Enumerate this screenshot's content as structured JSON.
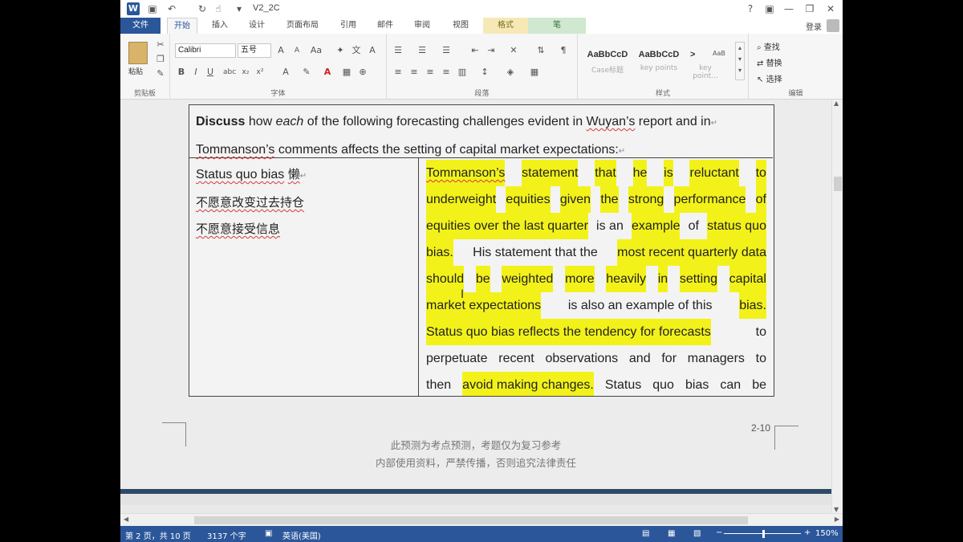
{
  "window": {
    "doc_title": "V2_2C",
    "help": "?",
    "min": "—",
    "restore": "❐",
    "close": "✕",
    "ribbon_display": "▣",
    "signin": "登录"
  },
  "tabs": {
    "file": "文件",
    "home": "开始",
    "insert": "插入",
    "design": "设计",
    "layout": "页面布局",
    "references": "引用",
    "mailings": "邮件",
    "review": "审阅",
    "view": "视图",
    "format": "格式",
    "pen": "笔"
  },
  "ribbon": {
    "clipboard": {
      "paste": "粘贴",
      "label": "剪贴板"
    },
    "font": {
      "name": "Calibri",
      "size": "五号",
      "label": "字体"
    },
    "paragraph": {
      "label": "段落"
    },
    "styles": {
      "label": "样式",
      "tiles": [
        {
          "sample": "AaBbCcD",
          "name": "Case标题"
        },
        {
          "sample": "AaBbCcD",
          "name": "key points"
        },
        {
          "sample": ">",
          "name": "key point..."
        }
      ],
      "more_sample": "AaB"
    },
    "editing": {
      "find": "查找",
      "replace": "替换",
      "select": "选择",
      "label": "编辑"
    }
  },
  "doc": {
    "question": {
      "b1": "Discuss",
      "t1": " how ",
      "i1": "each",
      "t2": " of the following forecasting challenges evident in ",
      "u1": "Wuyan’s",
      "t3": " report and in",
      "u2": "Tommanson’s",
      "t4": " comments affects the setting of capital market expectations:"
    },
    "left": {
      "l1": "Status quo bias",
      "l1_zh": "懒",
      "l2": "不愿意改变过去持仓",
      "l3": "不愿意接受信息"
    },
    "right_lines": [
      [
        {
          "t": "Tommanson’s",
          "hl": true,
          "u": true
        },
        {
          "t": "statement",
          "hl": true
        },
        {
          "t": "that",
          "hl": true
        },
        {
          "t": "he",
          "hl": true
        },
        {
          "t": "is",
          "hl": true
        },
        {
          "t": "reluctant",
          "hl": true
        },
        {
          "t": "to",
          "hl": true
        }
      ],
      [
        {
          "t": "underweight",
          "hl": true
        },
        {
          "t": "equities",
          "hl": true
        },
        {
          "t": "given",
          "hl": true
        },
        {
          "t": "the",
          "hl": true
        },
        {
          "t": "strong",
          "hl": true
        },
        {
          "t": "performance",
          "hl": true
        },
        {
          "t": "of",
          "hl": true
        }
      ],
      [
        {
          "t": "equities over the last quarter",
          "hl": true
        },
        {
          "t": "is an",
          "hl": false
        },
        {
          "t": "example",
          "hl": true
        },
        {
          "t": "of",
          "hl": false
        },
        {
          "t": "status quo",
          "hl": true
        }
      ],
      [
        {
          "t": "bias.",
          "hl": true
        },
        {
          "t": "His statement that the",
          "hl": false
        },
        {
          "t": "most recent quarterly data",
          "hl": true
        }
      ],
      [
        {
          "t": "should",
          "hl": true
        },
        {
          "t": "be",
          "hl": true
        },
        {
          "t": "weighted",
          "hl": true
        },
        {
          "t": "more",
          "hl": true
        },
        {
          "t": "heavily",
          "hl": true
        },
        {
          "t": "in",
          "hl": true
        },
        {
          "t": "setting",
          "hl": true
        },
        {
          "t": "capital",
          "hl": true
        }
      ],
      [
        {
          "t": "market expectations",
          "hl": true
        },
        {
          "t": "is also an example of this",
          "hl": false
        },
        {
          "t": "bias.",
          "hl": true
        }
      ],
      [
        {
          "t": "Status quo bias reflects the tendency for forecasts",
          "hl": true
        },
        {
          "t": "to",
          "hl": false
        }
      ],
      [
        {
          "t": "perpetuate",
          "hl": false
        },
        {
          "t": "recent",
          "hl": false
        },
        {
          "t": "observations",
          "hl": false
        },
        {
          "t": "and",
          "hl": false
        },
        {
          "t": "for",
          "hl": false
        },
        {
          "t": "managers",
          "hl": false
        },
        {
          "t": "to",
          "hl": false
        }
      ],
      [
        {
          "t": "then",
          "hl": false
        },
        {
          "t": "avoid making changes.",
          "hl": true
        },
        {
          "t": "Status",
          "hl": false
        },
        {
          "t": "quo",
          "hl": false
        },
        {
          "t": "bias",
          "hl": false
        },
        {
          "t": "can",
          "hl": false
        },
        {
          "t": "be",
          "hl": false
        }
      ]
    ],
    "page_num": "2-10",
    "footer1": "此预测为考点预测，考题仅为复习参考",
    "footer2": "内部使用资料，严禁传播，否则追究法律责任"
  },
  "status": {
    "page": "第 2 页，共 10 页",
    "words": "3137 个字",
    "lang": "英语(美国)",
    "zoom": "150%"
  },
  "colors": {
    "accent": "#2b579a",
    "highlight": "#f2f21a",
    "spell": "#d23a3a"
  }
}
